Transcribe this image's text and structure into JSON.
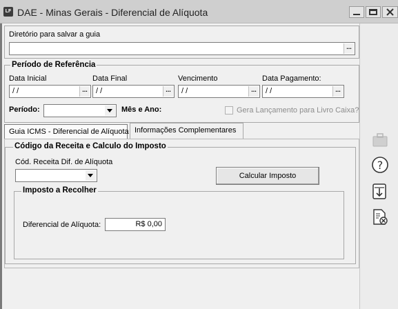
{
  "window": {
    "app_icon": "LF",
    "title": "DAE - Minas Gerais - Diferencial de Alíquota"
  },
  "directory": {
    "label": "Diretório para salvar a guia",
    "value": "",
    "browse": "..."
  },
  "periodo": {
    "title": "Período de Referência",
    "data_inicial_label": "Data Inicial",
    "data_inicial_value": "/ /",
    "data_final_label": "Data Final",
    "data_final_value": "/ /",
    "vencimento_label": "Vencimento",
    "vencimento_value": "/ /",
    "data_pagamento_label": "Data Pagamento:",
    "data_pagamento_value": "/ /",
    "browse": "...",
    "periodo_label": "Período:",
    "periodo_value": "",
    "mes_ano_label": "Mês e Ano:",
    "gera_lancamento_label": "Gera Lançamento para Livro Caixa?"
  },
  "tabs": [
    {
      "label": "Guia ICMS - Diferencial de Alíquota",
      "active": true
    },
    {
      "label": "Informações Complementares",
      "active": false
    }
  ],
  "codigo": {
    "title": "Código da Receita e Calculo do Imposto",
    "receita_label": "Cód. Receita Dif. de Alíquota",
    "receita_value": "",
    "calcular_button": "Calcular Imposto"
  },
  "imposto": {
    "title": "Imposto a Recolher",
    "diferencial_label": "Diferencial de  Alíquota:",
    "diferencial_value": "R$ 0,00"
  },
  "side_icons": [
    "briefcase-icon",
    "help-icon",
    "save-download-icon",
    "cancel-document-icon"
  ]
}
